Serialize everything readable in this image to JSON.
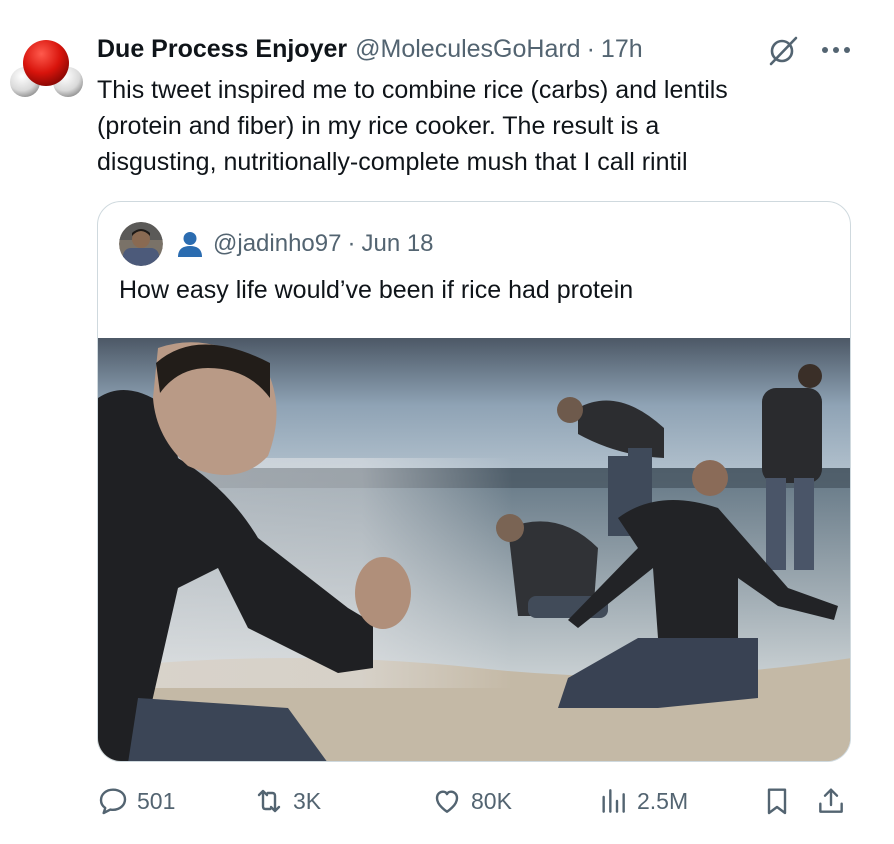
{
  "tweet": {
    "author_name": "Due Process Enjoyer",
    "handle": "@MoleculesGoHard",
    "separator": "·",
    "time": "17h",
    "text_lines": [
      "This tweet inspired me to combine rice (carbs) and lentils",
      "(protein and fiber) in my rice cooker.  The result is a",
      "disgusting, nutritionally-complete mush that I call rintil"
    ],
    "avatar_icon": "water-molecule-avatar",
    "grok_icon": "slashed-circle-icon",
    "more_icon": "more-dots-icon"
  },
  "quote": {
    "handle": "@jadinho97",
    "separator": "·",
    "date": "Jun 18",
    "text": "How easy life would’ve been if rice had protein",
    "badge_icon": "person-icon",
    "image": "beach-sand-meme-photo"
  },
  "actions": {
    "replies": "501",
    "reposts": "3K",
    "likes": "80K",
    "views": "2.5M"
  },
  "colors": {
    "text": "#0f1419",
    "secondary": "#536471",
    "border": "#cfd9de",
    "badge_blue": "#1d9bf0"
  }
}
